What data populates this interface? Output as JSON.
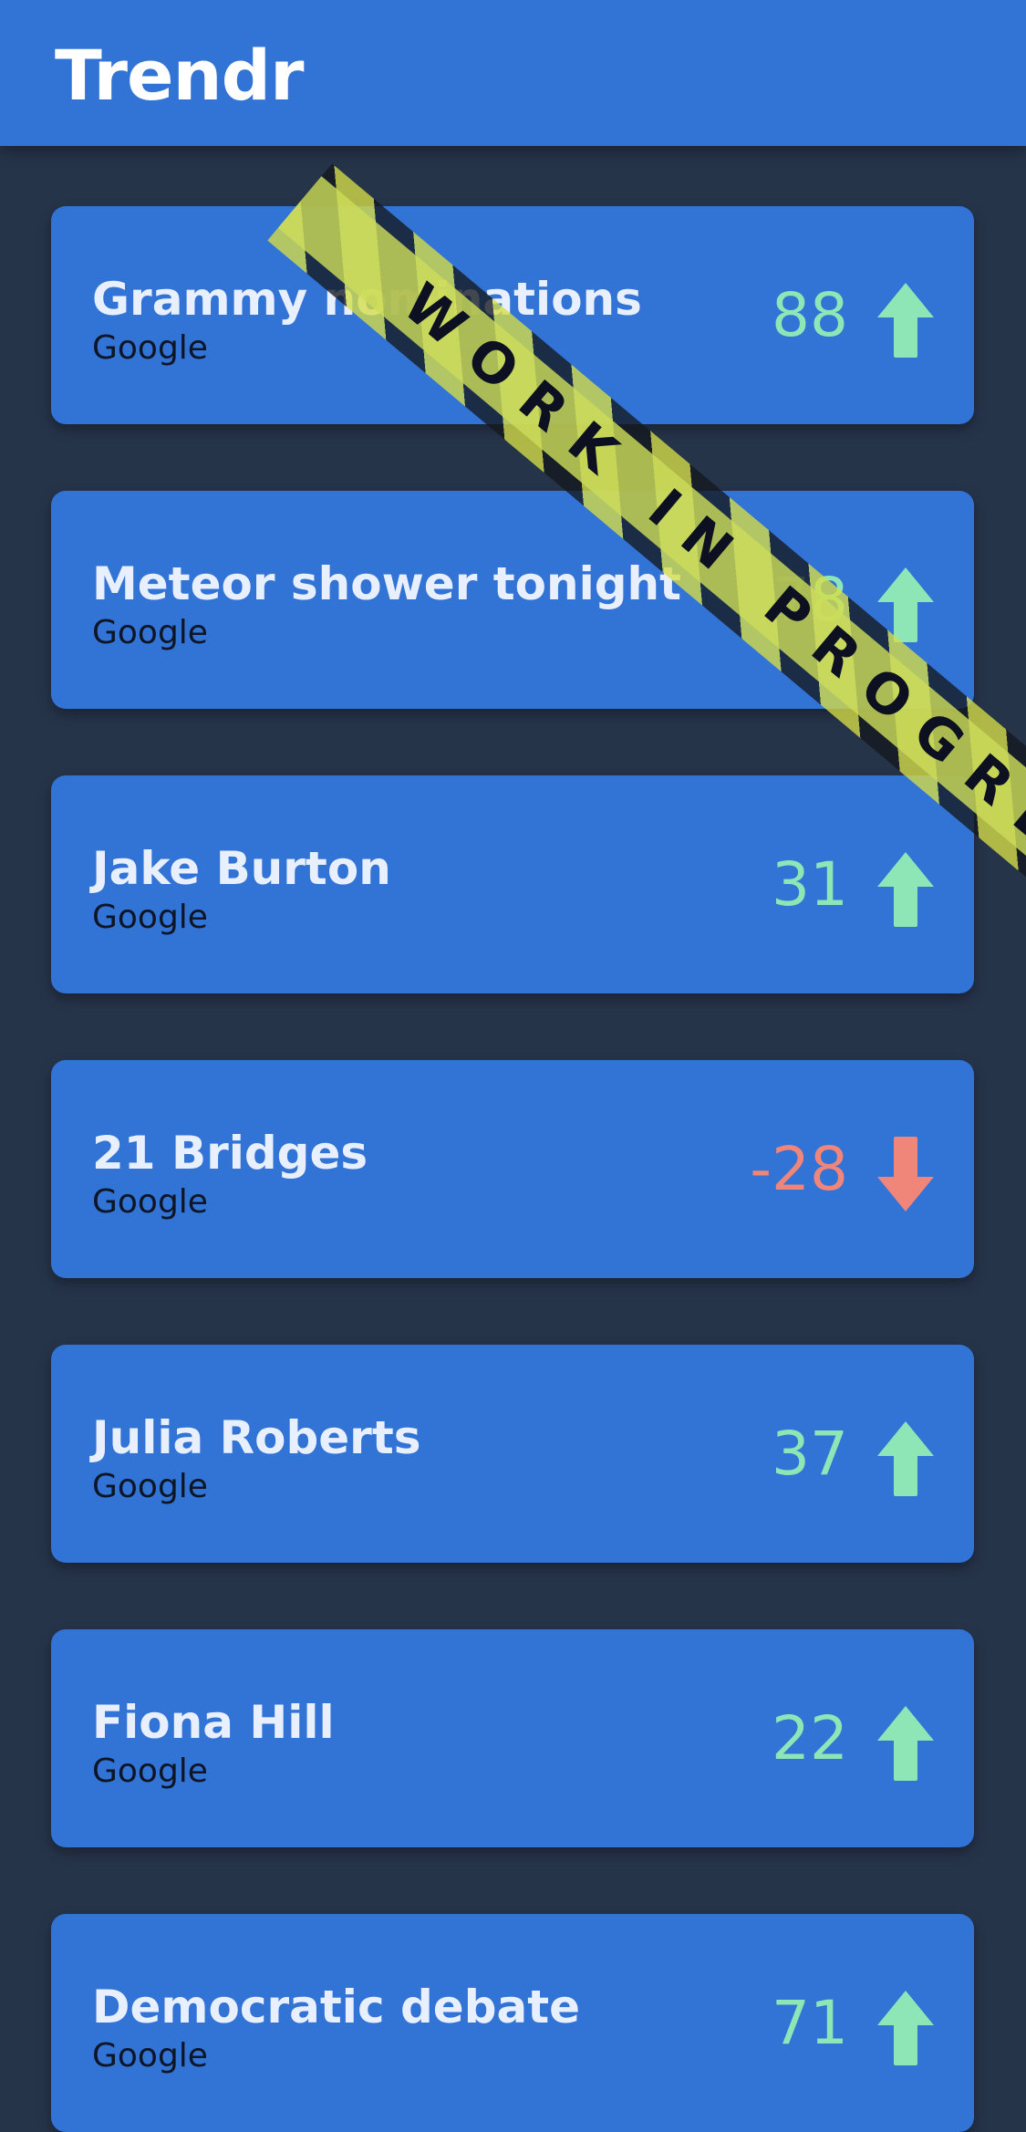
{
  "app": {
    "title": "Trendr"
  },
  "colors": {
    "up": "#8ee6b6",
    "down": "#f0857a"
  },
  "trends": [
    {
      "title": "Grammy nominations",
      "source": "Google",
      "score": "88",
      "direction": "up",
      "icon": "arrow-up-icon"
    },
    {
      "title": "Meteor shower tonight",
      "source": "Google",
      "score": "78",
      "direction": "up",
      "icon": "arrow-up-icon"
    },
    {
      "title": "Jake Burton",
      "source": "Google",
      "score": "31",
      "direction": "up",
      "icon": "arrow-up-icon"
    },
    {
      "title": "21 Bridges",
      "source": "Google",
      "score": "-28",
      "direction": "down",
      "icon": "arrow-down-icon"
    },
    {
      "title": "Julia Roberts",
      "source": "Google",
      "score": "37",
      "direction": "up",
      "icon": "arrow-up-icon"
    },
    {
      "title": "Fiona Hill",
      "source": "Google",
      "score": "22",
      "direction": "up",
      "icon": "arrow-up-icon"
    },
    {
      "title": "Democratic debate",
      "source": "Google",
      "score": "71",
      "direction": "up",
      "icon": "arrow-up-icon"
    }
  ],
  "overlay": {
    "banner_text": "WORK IN PROGRES"
  }
}
